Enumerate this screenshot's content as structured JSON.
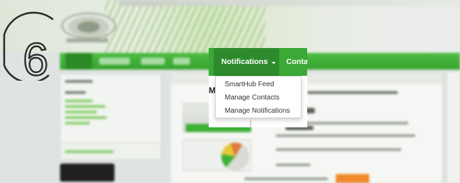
{
  "step": {
    "number": "6"
  },
  "nav": {
    "tabs": [
      {
        "label": "Notifications",
        "active": true
      },
      {
        "label": "Conta"
      }
    ]
  },
  "dropdown": {
    "items": [
      {
        "label": "SmartHub Feed"
      },
      {
        "label": "Manage Contacts"
      },
      {
        "label": "Manage Notifications"
      }
    ]
  },
  "content": {
    "partial_heading": "M"
  },
  "colors": {
    "nav_green": "#3aa935",
    "active_tab_green": "#2d8b2d",
    "text_dark": "#333333"
  }
}
